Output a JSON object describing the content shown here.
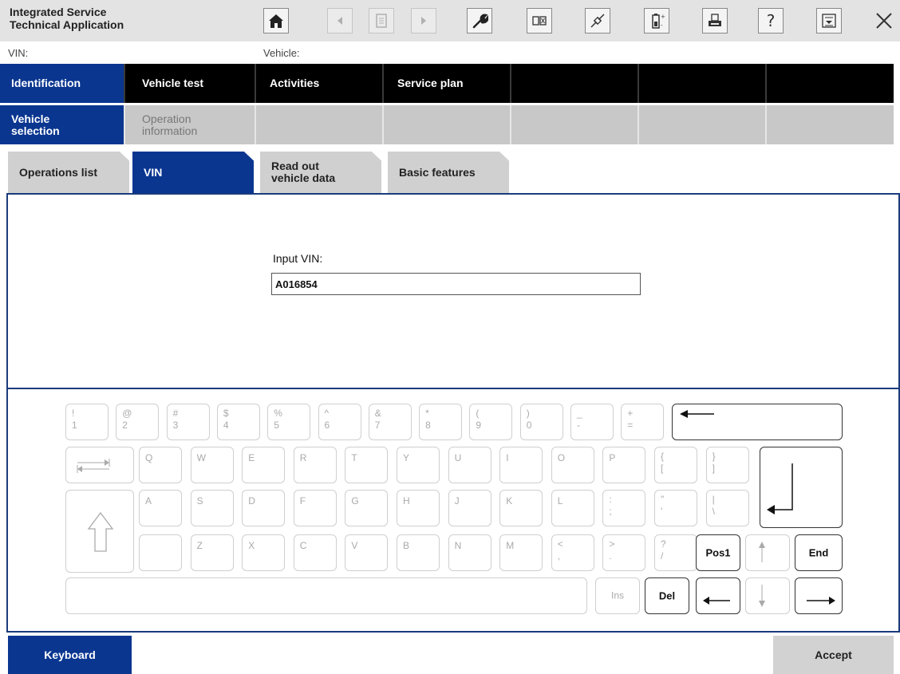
{
  "header": {
    "app_title": "Integrated Service\nTechnical Application",
    "toolbar": [
      {
        "icon": "home-icon",
        "enabled": true
      },
      {
        "icon": "arrow-left-icon",
        "enabled": false
      },
      {
        "icon": "document-icon",
        "enabled": false
      },
      {
        "icon": "arrow-right-icon",
        "enabled": false
      },
      {
        "icon": "wrench-icon",
        "enabled": true
      },
      {
        "icon": "compare-icon",
        "enabled": true
      },
      {
        "icon": "connection-icon",
        "enabled": true
      },
      {
        "icon": "battery-icon",
        "enabled": true
      },
      {
        "icon": "print-icon",
        "enabled": true
      },
      {
        "icon": "help-icon",
        "enabled": true
      },
      {
        "icon": "minimize-icon",
        "enabled": true
      },
      {
        "icon": "close-icon",
        "enabled": true
      }
    ]
  },
  "info": {
    "vin_label": "VIN:",
    "vehicle_label": "Vehicle:"
  },
  "main_nav": [
    {
      "label": "Identification",
      "active": true
    },
    {
      "label": "Vehicle test",
      "active": false
    },
    {
      "label": "Activities",
      "active": false
    },
    {
      "label": "Service plan",
      "active": false
    },
    {
      "label": "",
      "active": false
    },
    {
      "label": "",
      "active": false
    },
    {
      "label": "",
      "active": false
    }
  ],
  "sub_nav": [
    {
      "label": "Vehicle\nselection",
      "active": true
    },
    {
      "label": "Operation\ninformation",
      "active": false
    },
    {
      "label": "",
      "active": false
    },
    {
      "label": "",
      "active": false
    },
    {
      "label": "",
      "active": false
    },
    {
      "label": "",
      "active": false
    },
    {
      "label": "",
      "active": false
    }
  ],
  "tabs": [
    {
      "label": "Operations list",
      "active": false
    },
    {
      "label": "VIN",
      "active": true
    },
    {
      "label": "Read out\nvehicle data",
      "active": false
    },
    {
      "label": "Basic features",
      "active": false
    }
  ],
  "content": {
    "input_label": "Input VIN:",
    "vin_value": "A016854"
  },
  "keyboard": {
    "row1": [
      {
        "sym": "!",
        "base": "1"
      },
      {
        "sym": "@",
        "base": "2"
      },
      {
        "sym": "#",
        "base": "3"
      },
      {
        "sym": "$",
        "base": "4"
      },
      {
        "sym": "%",
        "base": "5"
      },
      {
        "sym": "^",
        "base": "6"
      },
      {
        "sym": "&",
        "base": "7"
      },
      {
        "sym": "*",
        "base": "8"
      },
      {
        "sym": "(",
        "base": "9"
      },
      {
        "sym": ")",
        "base": "0"
      },
      {
        "sym": "_",
        "base": "-"
      },
      {
        "sym": "+",
        "base": "="
      }
    ],
    "row2": [
      {
        "sym": "Q"
      },
      {
        "sym": "W"
      },
      {
        "sym": "E"
      },
      {
        "sym": "R"
      },
      {
        "sym": "T"
      },
      {
        "sym": "Y"
      },
      {
        "sym": "U"
      },
      {
        "sym": "I"
      },
      {
        "sym": "O"
      },
      {
        "sym": "P"
      },
      {
        "sym": "{",
        "base": "["
      },
      {
        "sym": "}",
        "base": "]"
      }
    ],
    "row3": [
      {
        "sym": "A"
      },
      {
        "sym": "S"
      },
      {
        "sym": "D"
      },
      {
        "sym": "F"
      },
      {
        "sym": "G"
      },
      {
        "sym": "H"
      },
      {
        "sym": "J"
      },
      {
        "sym": "K"
      },
      {
        "sym": "L"
      },
      {
        "sym": ":",
        "base": ";"
      },
      {
        "sym": "\"",
        "base": "'"
      },
      {
        "sym": "|",
        "base": "\\"
      }
    ],
    "row4": [
      {
        "sym": ""
      },
      {
        "sym": "Z"
      },
      {
        "sym": "X"
      },
      {
        "sym": "C"
      },
      {
        "sym": "V"
      },
      {
        "sym": "B"
      },
      {
        "sym": "N"
      },
      {
        "sym": "M"
      },
      {
        "sym": "<",
        "base": ","
      },
      {
        "sym": ">",
        "base": "."
      },
      {
        "sym": "?",
        "base": "/"
      }
    ],
    "pos1_label": "Pos1",
    "end_label": "End",
    "ins_label": "Ins",
    "del_label": "Del"
  },
  "footer": {
    "keyboard_label": "Keyboard",
    "accept_label": "Accept"
  },
  "colors": {
    "accent": "#0a3690",
    "nav_black": "#000000",
    "border_blue": "#1a3b7c"
  }
}
